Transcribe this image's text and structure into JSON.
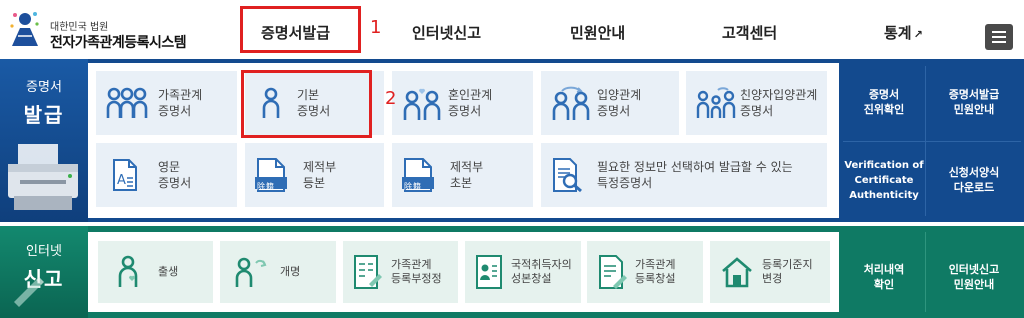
{
  "header": {
    "logo_small": "대한민국 법원",
    "logo_big": "전자가족관계등록시스템",
    "nav": [
      {
        "label": "증명서발급"
      },
      {
        "label": "인터넷신고"
      },
      {
        "label": "민원안내"
      },
      {
        "label": "고객센터"
      },
      {
        "label": "통계",
        "external_icon": "↗"
      }
    ],
    "menu_icon": "hamburger-icon"
  },
  "annotations": {
    "first": "1",
    "second": "2"
  },
  "issuance": {
    "title_small": "증명서",
    "title_big": "발급",
    "cards_row1": [
      {
        "label": "가족관계\n증명서",
        "icon": "family-icon"
      },
      {
        "label": "기본\n증명서",
        "icon": "person-icon"
      },
      {
        "label": "혼인관계\n증명서",
        "icon": "couple-heart-icon"
      },
      {
        "label": "입양관계\n증명서",
        "icon": "adoption-icon"
      },
      {
        "label": "친양자입양관계\n증명서",
        "icon": "family-adoption-icon"
      }
    ],
    "cards_row2": [
      {
        "label": "영문\n증명서",
        "icon": "english-document-icon"
      },
      {
        "label": "제적부\n등본",
        "icon": "removed-register-icon",
        "badge": "除籍"
      },
      {
        "label": "제적부\n초본",
        "icon": "removed-register-icon",
        "badge": "除籍"
      },
      {
        "label": "필요한 정보만 선택하여 발급할 수 있는\n특정증명서",
        "icon": "document-search-icon"
      }
    ],
    "side_links": [
      {
        "label": "증명서\n진위확인"
      },
      {
        "label": "증명서발급\n민원안내"
      },
      {
        "label": "Verification of\nCertificate\nAuthenticity"
      },
      {
        "label": "신청서양식\n다운로드"
      }
    ]
  },
  "report": {
    "title_small": "인터넷",
    "title_big": "신고",
    "cards": [
      {
        "label": "출생",
        "icon": "birth-icon"
      },
      {
        "label": "개명",
        "icon": "rename-icon"
      },
      {
        "label": "가족관계\n등록부정정",
        "icon": "correction-form-icon"
      },
      {
        "label": "국적취득자의\n성본창설",
        "icon": "nationality-id-icon"
      },
      {
        "label": "가족관계\n등록창설",
        "icon": "register-create-icon"
      },
      {
        "label": "등록기준지\n변경",
        "icon": "home-icon"
      }
    ],
    "side_links": [
      {
        "label": "처리내역\n확인"
      },
      {
        "label": "인터넷신고\n민원안내"
      }
    ]
  },
  "colors": {
    "issuance_band": "#134a8e",
    "report_band": "#0f7a64",
    "icon_blue": "#2f6db5",
    "icon_green": "#1f8a70",
    "annotation_red": "#e02020"
  }
}
